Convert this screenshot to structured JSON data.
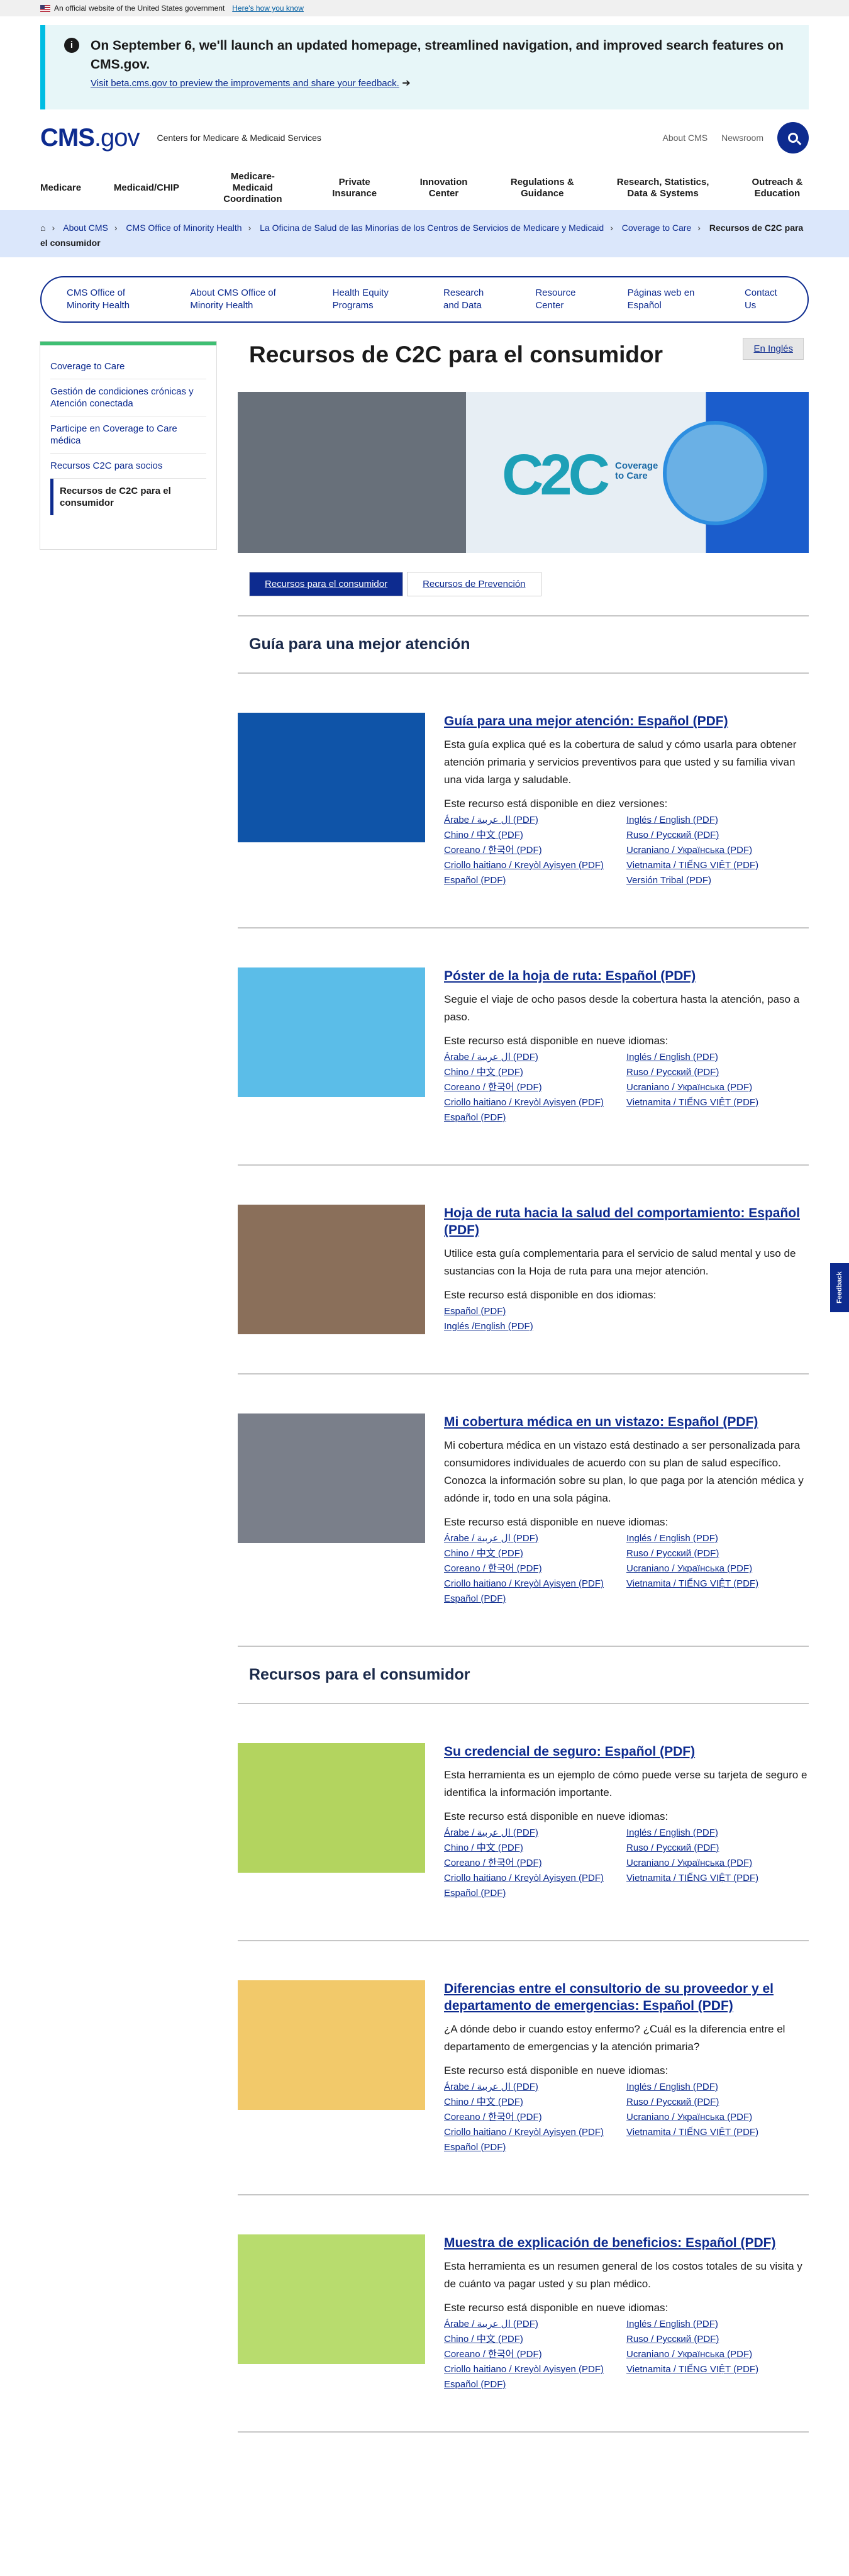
{
  "gov_banner": {
    "text": "An official website of the United States government",
    "link": "Here's how you know"
  },
  "alert": {
    "title": "On September 6, we'll launch an updated homepage, streamlined navigation, and improved search features on CMS.gov.",
    "link": "Visit beta.cms.gov to preview the improvements and share your feedback."
  },
  "header": {
    "logo_a": "CMS",
    "logo_b": ".gov",
    "tagline": "Centers for Medicare & Medicaid Services",
    "about": "About CMS",
    "newsroom": "Newsroom"
  },
  "mainnav": [
    "Medicare",
    "Medicaid/CHIP",
    "Medicare-Medicaid Coordination",
    "Private Insurance",
    "Innovation Center",
    "Regulations & Guidance",
    "Research, Statistics, Data & Systems",
    "Outreach & Education"
  ],
  "breadcrumbs": [
    "About CMS",
    "CMS Office of Minority Health",
    "La Oficina de Salud de las Minorías de los Centros de Servicios de Medicare y Medicaid",
    "Coverage to Care"
  ],
  "breadcrumb_current": "Recursos de C2C para el consumidor",
  "subnav": [
    "CMS Office of Minority Health",
    "About CMS Office of Minority Health",
    "Health Equity Programs",
    "Research and Data",
    "Resource Center",
    "Páginas web en Español",
    "Contact Us"
  ],
  "sidebar": [
    "Coverage to Care",
    "Gestión de condiciones crónicas y Atención conectada",
    "Participe en Coverage to Care médica",
    "Recursos C2C para socios",
    "Recursos de C2C para el consumidor"
  ],
  "page_title": "Recursos de C2C para el consumidor",
  "lang_button": "En Inglés",
  "hero": {
    "c2c": "C2C",
    "tag": "Coverage to Care"
  },
  "tabs": [
    "Recursos para el consumidor",
    "Recursos de Prevención"
  ],
  "section1": "Guía para una mejor atención",
  "section2": "Recursos para el consumidor",
  "feedback": "Feedback",
  "resources": [
    {
      "title": "Guía para una mejor atención: Español (PDF)",
      "desc": "Esta guía explica qué es la cobertura de salud y cómo usarla para obtener atención primaria y servicios preventivos para que usted y su familia vivan una vida larga y saludable.",
      "avail": "Este recurso está disponible en diez versiones:",
      "links": [
        "Árabe / ال عربية (PDF)",
        "Inglés / English (PDF)",
        "Chino / 中文 (PDF)",
        "Ruso / Русский (PDF)",
        "Coreano / 한국어 (PDF)",
        "Ucraniano / Українська (PDF)",
        "Criollo haitiano / Kreyòl Ayisyen (PDF)",
        "Vietnamita / TIẾNG VIỆT (PDF)",
        "Español (PDF)",
        "Versión Tribal (PDF)"
      ],
      "color": "#0f54a8"
    },
    {
      "title": "Póster de la hoja de ruta: Español (PDF)",
      "desc": "Seguie el viaje de ocho pasos desde la cobertura hasta la atención, paso a paso.",
      "avail": "Este recurso está disponible en nueve idiomas:",
      "links": [
        "Árabe / ال عربية (PDF)",
        "Inglés / English (PDF)",
        "Chino / 中文 (PDF)",
        "Ruso / Русский (PDF)",
        "Coreano / 한국어 (PDF)",
        "Ucraniano / Українська (PDF)",
        "Criollo haitiano / Kreyòl Ayisyen (PDF)",
        "Vietnamita / TIẾNG VIỆT (PDF)",
        "Español (PDF)"
      ],
      "color": "#5bbde8"
    },
    {
      "title": "Hoja de ruta hacia la salud del comportamiento: Español (PDF)",
      "desc": "Utilice esta guía complementaria para el servicio de salud mental y uso de sustancias con la Hoja de ruta para una mejor atención.",
      "avail": "Este recurso está disponible en dos idiomas:",
      "links": [
        "Español (PDF)",
        "Inglés /English (PDF)"
      ],
      "single": true,
      "color": "#8a6f5a"
    },
    {
      "title": "Mi cobertura médica en un vistazo: Español (PDF)",
      "desc": "Mi cobertura médica en un vistazo está destinado a ser personalizada para consumidores individuales de acuerdo con su plan de salud específico. Conozca la información sobre su plan, lo que paga por la atención médica y adónde ir, todo en una sola página.",
      "avail": "Este recurso está disponible en nueve idiomas:",
      "links": [
        "Árabe / ال عربية (PDF)",
        "Inglés / English (PDF)",
        "Chino / 中文 (PDF)",
        "Ruso / Русский (PDF)",
        "Coreano / 한국어 (PDF)",
        "Ucraniano / Українська (PDF)",
        "Criollo haitiano / Kreyòl Ayisyen (PDF)",
        "Vietnamita / TIẾNG VIỆT (PDF)",
        "Español (PDF)"
      ],
      "color": "#7a7f8a"
    },
    {
      "title": "Su credencial de seguro: Español (PDF)",
      "desc": "Esta herramienta es un ejemplo de cómo puede verse su tarjeta de seguro e identifica la información importante.",
      "avail": "Este recurso está disponible en nueve idiomas:",
      "links": [
        "Árabe / ال عربية (PDF)",
        "Inglés / English (PDF)",
        "Chino / 中文 (PDF)",
        "Ruso / Русский (PDF)",
        "Coreano / 한국어 (PDF)",
        "Ucraniano / Українська (PDF)",
        "Criollo haitiano / Kreyòl Ayisyen (PDF)",
        "Vietnamita / TIẾNG VIỆT (PDF)",
        "Español (PDF)"
      ],
      "color": "#b3d45f"
    },
    {
      "title": "Diferencias entre el consultorio de su proveedor y el departamento de emergencias: Español (PDF)",
      "desc": "¿A dónde debo ir cuando estoy enfermo? ¿Cuál es la diferencia entre el departamento de emergencias y la atención primaria?",
      "avail": "Este recurso está disponible en nueve idiomas:",
      "links": [
        "Árabe / ال عربية (PDF)",
        "Inglés / English (PDF)",
        "Chino / 中文 (PDF)",
        "Ruso / Русский (PDF)",
        "Coreano / 한국어 (PDF)",
        "Ucraniano / Українська (PDF)",
        "Criollo haitiano / Kreyòl Ayisyen (PDF)",
        "Vietnamita / TIẾNG VIỆT (PDF)",
        "Español (PDF)"
      ],
      "color": "#f2c96a"
    },
    {
      "title": "Muestra de explicación de beneficios: Español (PDF)",
      "desc": "Esta herramienta es un resumen general de los costos totales de su visita y de cuánto va pagar usted y su plan médico.",
      "avail": "Este recurso está disponible en nueve idiomas:",
      "links": [
        "Árabe / ال عربية (PDF)",
        "Inglés / English (PDF)",
        "Chino / 中文 (PDF)",
        "Ruso / Русский (PDF)",
        "Coreano / 한국어 (PDF)",
        "Ucraniano / Українська (PDF)",
        "Criollo haitiano / Kreyòl Ayisyen (PDF)",
        "Vietnamita / TIẾNG VIỆT (PDF)",
        "Español (PDF)"
      ],
      "color": "#b8dc6e"
    }
  ]
}
